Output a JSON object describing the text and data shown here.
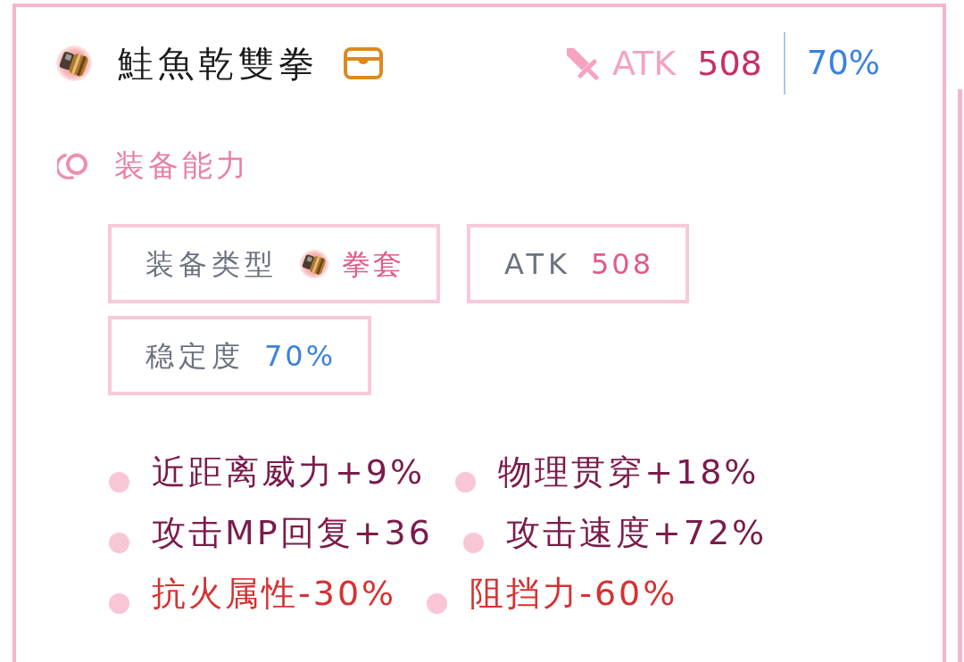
{
  "item": {
    "name": "鮭魚乾雙拳",
    "attack": {
      "label": "ATK",
      "value": "508"
    },
    "stability": "70%"
  },
  "abilities": {
    "title": "装备能力",
    "stats": [
      {
        "kind": "type",
        "label": "装备类型",
        "value": "拳套"
      },
      {
        "kind": "attack",
        "label": "ATK",
        "value": "508"
      },
      {
        "kind": "stability",
        "label": "稳定度",
        "value": "70%"
      }
    ],
    "effects": [
      {
        "kind": "positive",
        "text": "近距离威力+9%"
      },
      {
        "kind": "positive",
        "text": "物理贯穿+18%"
      },
      {
        "kind": "positive",
        "text": "攻击MP回复+36"
      },
      {
        "kind": "positive",
        "text": "攻击速度+72%"
      },
      {
        "kind": "negative",
        "text": "抗火属性-30%"
      },
      {
        "kind": "negative",
        "text": "阻挡力-60%"
      }
    ]
  }
}
